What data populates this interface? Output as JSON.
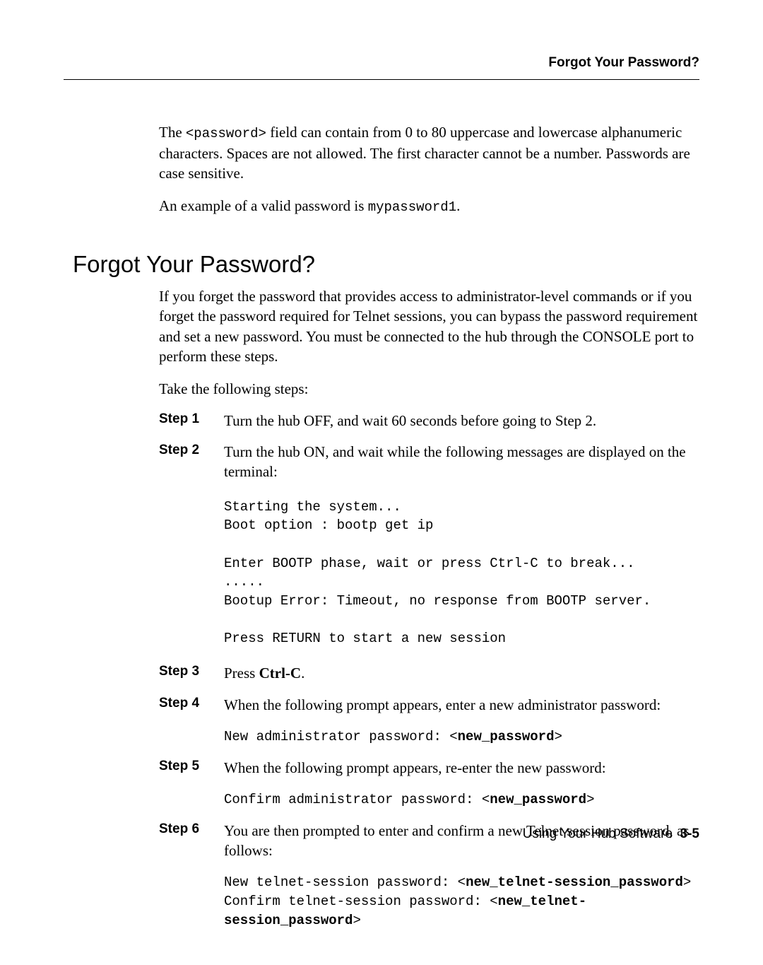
{
  "header": {
    "title": "Forgot Your Password?"
  },
  "intro": {
    "p1_pre": "The ",
    "p1_code": "<password>",
    "p1_post": " field can contain from 0 to 80 uppercase and lowercase alphanumeric characters. Spaces are not allowed. The first character cannot be a number. Passwords are case sensitive.",
    "p2_pre": "An example of a valid password is ",
    "p2_code": "mypassword1",
    "p2_post": "."
  },
  "section": {
    "title": "Forgot Your Password?",
    "p1": "If you forget the password that provides access to administrator-level commands or if you forget the password required for Telnet sessions, you can bypass the password requirement and set a new password. You must be connected to the hub through the CONSOLE port to perform these steps.",
    "p2": "Take the following steps:"
  },
  "steps": {
    "s1": {
      "label": "Step 1",
      "text": "Turn the hub OFF, and wait 60 seconds before going to Step 2."
    },
    "s2": {
      "label": "Step 2",
      "text": "Turn the hub ON, and wait while the following messages are displayed on the terminal:",
      "terminal": "Starting the system...\nBoot option : bootp get ip\n\nEnter BOOTP phase, wait or press Ctrl-C to break...\n.....\nBootup Error: Timeout, no response from BOOTP server.\n\nPress RETURN to start a new session"
    },
    "s3": {
      "label": "Step 3",
      "text_pre": "Press ",
      "text_bold": "Ctrl-C",
      "text_post": "."
    },
    "s4": {
      "label": "Step 4",
      "text": "When the following prompt appears, enter a new administrator password:",
      "term_pre": "New administrator password: <",
      "term_bold": "new_password",
      "term_post": ">"
    },
    "s5": {
      "label": "Step 5",
      "text": "When the following prompt appears, re-enter the new password:",
      "term_pre": "Confirm administrator password: <",
      "term_bold": "new_password",
      "term_post": ">"
    },
    "s6": {
      "label": "Step 6",
      "text": "You are then prompted to enter and confirm a new Telnet session password, as follows:",
      "line1_pre": "New telnet-session password: <",
      "line1_bold": "new_telnet-session_password",
      "line1_post": ">",
      "line2_pre": "Confirm telnet-session password: <",
      "line2_bold": "new_telnet-session_password",
      "line2_post": ">"
    }
  },
  "footer": {
    "text": "Using Your Hub Software",
    "pagenum": "3-5"
  }
}
